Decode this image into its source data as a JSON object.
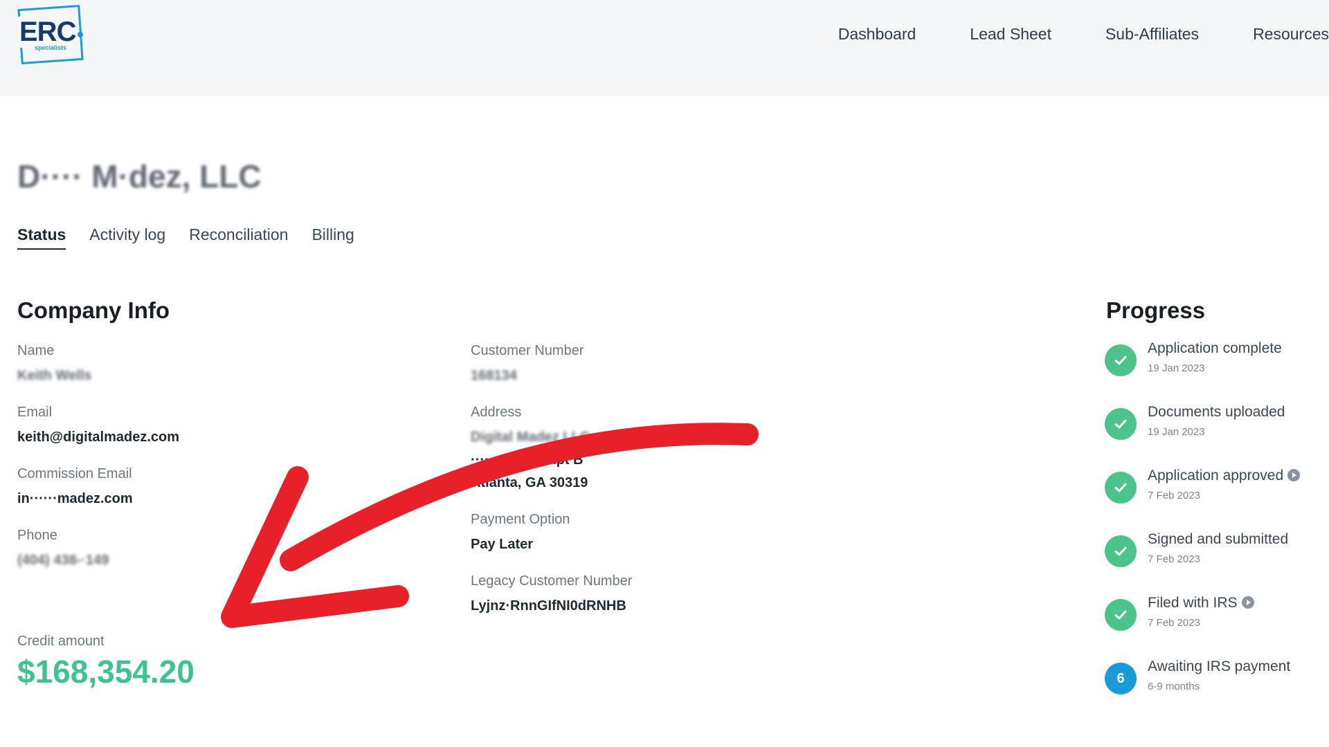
{
  "brand": {
    "logo_text": "ERC",
    "logo_sub": "specialists"
  },
  "nav": [
    "Dashboard",
    "Lead Sheet",
    "Sub-Affiliates",
    "Resources"
  ],
  "company": {
    "title": "D···· M·dez, LLC"
  },
  "tabs": [
    "Status",
    "Activity log",
    "Reconciliation",
    "Billing"
  ],
  "company_info": {
    "heading": "Company Info",
    "name_label": "Name",
    "name_value": "Keith Wells",
    "email_label": "Email",
    "email_value": "keith@digitalmadez.com",
    "commission_email_label": "Commission Email",
    "commission_email_value": "in······madez.com",
    "phone_label": "Phone",
    "phone_value": "(404) 438-·149",
    "customer_number_label": "Customer Number",
    "customer_number_value": "168134",
    "address_label": "Address",
    "address_line1": "Digital Madez LLC",
    "address_line2": "········en Dr Apt B",
    "address_line3": "Atlanta, GA 30319",
    "payment_option_label": "Payment Option",
    "payment_option_value": "Pay Later",
    "legacy_customer_number_label": "Legacy Customer Number",
    "legacy_customer_number_value": "Lyjnz·RnnGIfNI0dRNHB",
    "credit_amount_label": "Credit amount",
    "credit_amount_value": "$168,354.20"
  },
  "progress": {
    "heading": "Progress",
    "steps": [
      {
        "title": "Application complete",
        "date": "19 Jan 2023",
        "status": "done"
      },
      {
        "title": "Documents uploaded",
        "date": "19 Jan 2023",
        "status": "done"
      },
      {
        "title": "Application approved",
        "date": "7 Feb 2023",
        "status": "done"
      },
      {
        "title": "Signed and submitted",
        "date": "7 Feb 2023",
        "status": "done"
      },
      {
        "title": "Filed with IRS",
        "date": "7 Feb 2023",
        "status": "done"
      },
      {
        "title": "Awaiting IRS payment",
        "date": "6-9 months",
        "status": "current",
        "step_number": "6"
      }
    ]
  },
  "colors": {
    "accent_blue": "#1a9ad6",
    "success_green": "#4cc38a",
    "credit_green": "#3ec28f",
    "arrow_red": "#e8202a"
  }
}
